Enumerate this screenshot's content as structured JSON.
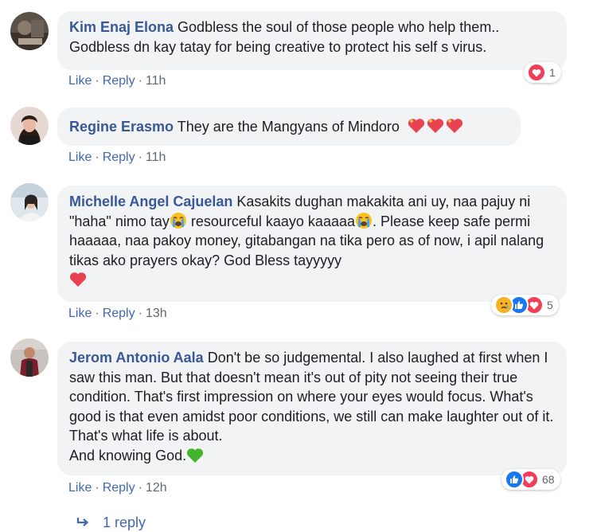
{
  "action_labels": {
    "like": "Like",
    "reply": "Reply",
    "separator": "·"
  },
  "comments": [
    {
      "author": "Kim Enaj Elona",
      "text": "Godbless the soul of those people who help them.. Godbless dn kay tatay for being creative to protect his self s virus.",
      "time": "11h",
      "reactions": [
        "love-react-icon"
      ],
      "reaction_count": "1"
    },
    {
      "author": "Regine Erasmo",
      "text": "They are the Mangyans of Mindoro",
      "emoji_suffix": [
        "sparkling-heart-icon",
        "sparkling-heart-icon",
        "sparkling-heart-icon"
      ],
      "time": "11h"
    },
    {
      "author": "Michelle Angel Cajuelan",
      "text_part1": "Kasakits dughan makakita ani uy, naa pajuy ni \"haha\" nimo tay",
      "text_part2": " resourceful kaayo kaaaaa",
      "text_part3": ". Please keep safe permi haaaaa, naa pakoy money, gitabangan na tika pero as of now, i apil nalang tikas ako prayers okay? God Bless tayyyyy",
      "time": "13h",
      "reactions": [
        "sad-react-icon",
        "like-react-icon",
        "love-react-icon"
      ],
      "reaction_count": "5"
    },
    {
      "author": "Jerom Antonio Aala",
      "text": "Don't be so judgemental. I also laughed at first when I saw this man. But that doesn't mean it's out of pity not seeing their true condition. That's first impression on where your eyes would focus. What's good is that even amidst poor conditions, we still can make laughter out of it. That's what life is about.",
      "text_line2": "And knowing God.",
      "time": "12h",
      "reactions": [
        "like-react-icon",
        "love-react-icon"
      ],
      "reaction_count": "68"
    }
  ],
  "replies_link": "1 reply",
  "colors": {
    "author": "#385898",
    "bubble": "#f2f3f5",
    "link": "#4267b2",
    "meta": "#606770",
    "like_blue": "#1877f2",
    "love_red": "#f33e58",
    "sad_yellow": "#f7b125"
  }
}
